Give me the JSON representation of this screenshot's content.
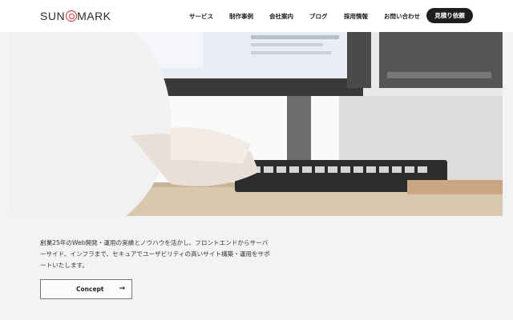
{
  "brand": {
    "logo_left": "SUN",
    "logo_right": "MARK"
  },
  "nav": {
    "items": [
      "サービス",
      "制作事例",
      "会社案内",
      "ブログ",
      "採用情報",
      "お問い合わせ"
    ],
    "estimate_label": "見積り依頼"
  },
  "intro": {
    "text": "創業25年のWeb開発・運用の実績とノウハウを活かし、フロントエンドからサーバーサイド、インフラまで、セキュアでユーザビリティの高いサイト構築・運用をサポートいたします。"
  },
  "concept_button": {
    "label": "Concept",
    "icon": "arrow-right-icon"
  },
  "colors": {
    "accent": "#c8323c",
    "dark": "#1e1e1e"
  }
}
